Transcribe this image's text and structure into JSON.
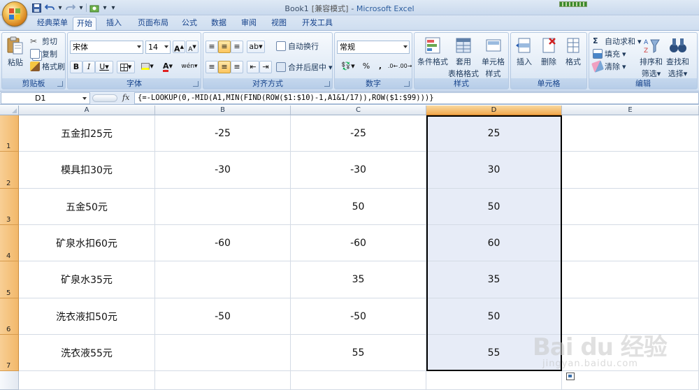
{
  "window": {
    "title": "Book1",
    "mode": "[兼容模式]",
    "app": "Microsoft Excel"
  },
  "tabs": [
    "经典菜单",
    "开始",
    "插入",
    "页面布局",
    "公式",
    "数据",
    "审阅",
    "视图",
    "开发工具"
  ],
  "active_tab": "开始",
  "ribbon": {
    "clipboard": {
      "label": "剪贴板",
      "paste": "粘贴",
      "cut": "剪切",
      "copy": "复制",
      "format_painter": "格式刷"
    },
    "font": {
      "label": "字体",
      "font_name": "宋体",
      "font_size": "14",
      "bold": "B",
      "italic": "I",
      "underline": "U"
    },
    "alignment": {
      "label": "对齐方式",
      "wrap": "自动换行",
      "merge": "合并后居中"
    },
    "number": {
      "label": "数字",
      "format": "常规",
      "percent": "%",
      "comma": ","
    },
    "styles": {
      "label": "样式",
      "conditional": "条件格式",
      "table_1": "套用",
      "table_2": "表格格式",
      "cell_1": "单元格",
      "cell_2": "样式"
    },
    "cells": {
      "label": "单元格",
      "insert": "插入",
      "delete": "删除",
      "format": "格式"
    },
    "editing": {
      "label": "编辑",
      "autosum": "自动求和",
      "fill": "填充",
      "clear": "清除",
      "sort_1": "排序和",
      "sort_2": "筛选",
      "find_1": "查找和",
      "find_2": "选择"
    }
  },
  "formula_bar": {
    "name_box": "D1",
    "fx": "fx",
    "formula": "{=-LOOKUP(0,-MID(A1,MIN(FIND(ROW($1:$10)-1,A1&1/17)),ROW($1:$99)))}"
  },
  "columns": [
    "A",
    "B",
    "C",
    "D",
    "E"
  ],
  "selected_column": "D",
  "rows": [
    {
      "num": "1",
      "a": "五金扣25元",
      "b": "-25",
      "c": "-25",
      "d": "25"
    },
    {
      "num": "2",
      "a": "模具扣30元",
      "b": "-30",
      "c": "-30",
      "d": "30"
    },
    {
      "num": "3",
      "a": "五金50元",
      "b": "",
      "c": "50",
      "d": "50"
    },
    {
      "num": "4",
      "a": "矿泉水扣60元",
      "b": "-60",
      "c": "-60",
      "d": "60"
    },
    {
      "num": "5",
      "a": "矿泉水35元",
      "b": "",
      "c": "35",
      "d": "35"
    },
    {
      "num": "6",
      "a": "洗衣液扣50元",
      "b": "-50",
      "c": "-50",
      "d": "50"
    },
    {
      "num": "7",
      "a": "洗衣液55元",
      "b": "",
      "c": "55",
      "d": "55"
    }
  ],
  "watermark": {
    "main": "Bai du 经验",
    "sub": "jingyan.baidu.com"
  }
}
